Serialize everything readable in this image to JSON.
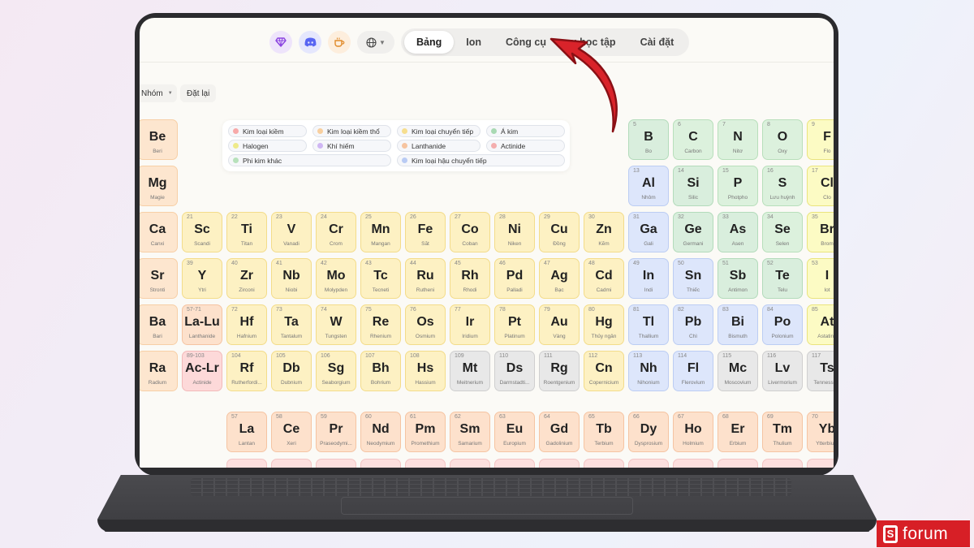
{
  "nav": {
    "tabs": [
      {
        "label": "Bảng",
        "active": true
      },
      {
        "label": "Ion",
        "active": false
      },
      {
        "label": "Công cụ",
        "active": false
      },
      {
        "label": "u học tập",
        "active": false
      },
      {
        "label": "Cài đặt",
        "active": false
      }
    ],
    "icons": [
      "gem-icon",
      "discord-icon",
      "coffee-icon",
      "globe-icon"
    ]
  },
  "controls": {
    "group_label": "Nhóm",
    "reset_label": "Đặt lại"
  },
  "legend": [
    {
      "label": "Kim loại kiềm",
      "color": "#f7a9a9"
    },
    {
      "label": "Kim loại kiềm thổ",
      "color": "#f8cf9f"
    },
    {
      "label": "Kim loại chuyển tiếp",
      "color": "#f6de8f"
    },
    {
      "label": "Á kim",
      "color": "#a9d9b3"
    },
    {
      "label": "Halogen",
      "color": "#eeea8a"
    },
    {
      "label": "Khí hiếm",
      "color": "#cfb6f3"
    },
    {
      "label": "Lanthanide",
      "color": "#f6c4a0"
    },
    {
      "label": "Actinide",
      "color": "#f4aeae"
    },
    {
      "label": "Phi kim khác",
      "color": "#b7e1bb"
    },
    {
      "label": "Kim loại hậu chuyển tiếp",
      "color": "#b9cbf4"
    }
  ],
  "elements": [
    {
      "sym": "Be",
      "name": "Beri",
      "num": "",
      "col": 0,
      "row": 0,
      "cat": "alkaline"
    },
    {
      "sym": "Mg",
      "name": "Magie",
      "num": "",
      "col": 0,
      "row": 1,
      "cat": "alkaline"
    },
    {
      "sym": "Ca",
      "name": "Canxi",
      "num": "",
      "col": 0,
      "row": 2,
      "cat": "alkaline"
    },
    {
      "sym": "Sr",
      "name": "Stronti",
      "num": "",
      "col": 0,
      "row": 3,
      "cat": "alkaline"
    },
    {
      "sym": "Ba",
      "name": "Bari",
      "num": "",
      "col": 0,
      "row": 4,
      "cat": "alkaline"
    },
    {
      "sym": "Ra",
      "name": "Radium",
      "num": "",
      "col": 0,
      "row": 5,
      "cat": "alkaline"
    },
    {
      "sym": "Sc",
      "name": "Scandi",
      "num": "21",
      "col": 1,
      "row": 2,
      "cat": "transition"
    },
    {
      "sym": "Ti",
      "name": "Titan",
      "num": "22",
      "col": 2,
      "row": 2,
      "cat": "transition"
    },
    {
      "sym": "V",
      "name": "Vanadi",
      "num": "23",
      "col": 3,
      "row": 2,
      "cat": "transition"
    },
    {
      "sym": "Cr",
      "name": "Crom",
      "num": "24",
      "col": 4,
      "row": 2,
      "cat": "transition"
    },
    {
      "sym": "Mn",
      "name": "Mangan",
      "num": "25",
      "col": 5,
      "row": 2,
      "cat": "transition"
    },
    {
      "sym": "Fe",
      "name": "Sắt",
      "num": "26",
      "col": 6,
      "row": 2,
      "cat": "transition"
    },
    {
      "sym": "Co",
      "name": "Coban",
      "num": "27",
      "col": 7,
      "row": 2,
      "cat": "transition"
    },
    {
      "sym": "Ni",
      "name": "Niken",
      "num": "28",
      "col": 8,
      "row": 2,
      "cat": "transition"
    },
    {
      "sym": "Cu",
      "name": "Đồng",
      "num": "29",
      "col": 9,
      "row": 2,
      "cat": "transition"
    },
    {
      "sym": "Zn",
      "name": "Kẽm",
      "num": "30",
      "col": 10,
      "row": 2,
      "cat": "transition"
    },
    {
      "sym": "Y",
      "name": "Ytri",
      "num": "39",
      "col": 1,
      "row": 3,
      "cat": "transition"
    },
    {
      "sym": "Zr",
      "name": "Zirconi",
      "num": "40",
      "col": 2,
      "row": 3,
      "cat": "transition"
    },
    {
      "sym": "Nb",
      "name": "Niobi",
      "num": "41",
      "col": 3,
      "row": 3,
      "cat": "transition"
    },
    {
      "sym": "Mo",
      "name": "Molypden",
      "num": "42",
      "col": 4,
      "row": 3,
      "cat": "transition"
    },
    {
      "sym": "Tc",
      "name": "Tecneti",
      "num": "43",
      "col": 5,
      "row": 3,
      "cat": "transition"
    },
    {
      "sym": "Ru",
      "name": "Rutheni",
      "num": "44",
      "col": 6,
      "row": 3,
      "cat": "transition"
    },
    {
      "sym": "Rh",
      "name": "Rhodi",
      "num": "45",
      "col": 7,
      "row": 3,
      "cat": "transition"
    },
    {
      "sym": "Pd",
      "name": "Palladi",
      "num": "46",
      "col": 8,
      "row": 3,
      "cat": "transition"
    },
    {
      "sym": "Ag",
      "name": "Bạc",
      "num": "47",
      "col": 9,
      "row": 3,
      "cat": "transition"
    },
    {
      "sym": "Cd",
      "name": "Cadmi",
      "num": "48",
      "col": 10,
      "row": 3,
      "cat": "transition"
    },
    {
      "sym": "La-Lu",
      "name": "Lanthanide",
      "num": "57-71",
      "col": 1,
      "row": 4,
      "cat": "lanthanide"
    },
    {
      "sym": "Hf",
      "name": "Hafnium",
      "num": "72",
      "col": 2,
      "row": 4,
      "cat": "transition"
    },
    {
      "sym": "Ta",
      "name": "Tantalum",
      "num": "73",
      "col": 3,
      "row": 4,
      "cat": "transition"
    },
    {
      "sym": "W",
      "name": "Tungsten",
      "num": "74",
      "col": 4,
      "row": 4,
      "cat": "transition"
    },
    {
      "sym": "Re",
      "name": "Rhenium",
      "num": "75",
      "col": 5,
      "row": 4,
      "cat": "transition"
    },
    {
      "sym": "Os",
      "name": "Osmium",
      "num": "76",
      "col": 6,
      "row": 4,
      "cat": "transition"
    },
    {
      "sym": "Ir",
      "name": "Iridium",
      "num": "77",
      "col": 7,
      "row": 4,
      "cat": "transition"
    },
    {
      "sym": "Pt",
      "name": "Platinum",
      "num": "78",
      "col": 8,
      "row": 4,
      "cat": "transition"
    },
    {
      "sym": "Au",
      "name": "Vàng",
      "num": "79",
      "col": 9,
      "row": 4,
      "cat": "transition"
    },
    {
      "sym": "Hg",
      "name": "Thủy ngân",
      "num": "80",
      "col": 10,
      "row": 4,
      "cat": "transition"
    },
    {
      "sym": "Ac-Lr",
      "name": "Actinide",
      "num": "89-103",
      "col": 1,
      "row": 5,
      "cat": "actinide"
    },
    {
      "sym": "Rf",
      "name": "Rutherfordi...",
      "num": "104",
      "col": 2,
      "row": 5,
      "cat": "transition"
    },
    {
      "sym": "Db",
      "name": "Dubnium",
      "num": "105",
      "col": 3,
      "row": 5,
      "cat": "transition"
    },
    {
      "sym": "Sg",
      "name": "Seaborgium",
      "num": "106",
      "col": 4,
      "row": 5,
      "cat": "transition"
    },
    {
      "sym": "Bh",
      "name": "Bohrium",
      "num": "107",
      "col": 5,
      "row": 5,
      "cat": "transition"
    },
    {
      "sym": "Hs",
      "name": "Hassium",
      "num": "108",
      "col": 6,
      "row": 5,
      "cat": "transition"
    },
    {
      "sym": "Mt",
      "name": "Meitnerium",
      "num": "109",
      "col": 7,
      "row": 5,
      "cat": "unknown"
    },
    {
      "sym": "Ds",
      "name": "Darmstadti...",
      "num": "110",
      "col": 8,
      "row": 5,
      "cat": "unknown"
    },
    {
      "sym": "Rg",
      "name": "Roentgenium",
      "num": "111",
      "col": 9,
      "row": 5,
      "cat": "unknown"
    },
    {
      "sym": "Cn",
      "name": "Copernicium",
      "num": "112",
      "col": 10,
      "row": 5,
      "cat": "transition"
    },
    {
      "sym": "B",
      "name": "Bo",
      "num": "5",
      "col": 11,
      "row": 0,
      "cat": "metalloid"
    },
    {
      "sym": "C",
      "name": "Carbon",
      "num": "6",
      "col": 12,
      "row": 0,
      "cat": "nonmetal"
    },
    {
      "sym": "N",
      "name": "Nitơ",
      "num": "7",
      "col": 13,
      "row": 0,
      "cat": "nonmetal"
    },
    {
      "sym": "O",
      "name": "Oxy",
      "num": "8",
      "col": 14,
      "row": 0,
      "cat": "nonmetal"
    },
    {
      "sym": "F",
      "name": "Flo",
      "num": "9",
      "col": 15,
      "row": 0,
      "cat": "halogen"
    },
    {
      "sym": "Al",
      "name": "Nhôm",
      "num": "13",
      "col": 11,
      "row": 1,
      "cat": "post"
    },
    {
      "sym": "Si",
      "name": "Silic",
      "num": "14",
      "col": 12,
      "row": 1,
      "cat": "metalloid"
    },
    {
      "sym": "P",
      "name": "Photpho",
      "num": "15",
      "col": 13,
      "row": 1,
      "cat": "nonmetal"
    },
    {
      "sym": "S",
      "name": "Lưu huỳnh",
      "num": "16",
      "col": 14,
      "row": 1,
      "cat": "nonmetal"
    },
    {
      "sym": "Cl",
      "name": "Clo",
      "num": "17",
      "col": 15,
      "row": 1,
      "cat": "halogen"
    },
    {
      "sym": "Ga",
      "name": "Gali",
      "num": "31",
      "col": 11,
      "row": 2,
      "cat": "post"
    },
    {
      "sym": "Ge",
      "name": "Germani",
      "num": "32",
      "col": 12,
      "row": 2,
      "cat": "metalloid"
    },
    {
      "sym": "As",
      "name": "Asen",
      "num": "33",
      "col": 13,
      "row": 2,
      "cat": "metalloid"
    },
    {
      "sym": "Se",
      "name": "Selen",
      "num": "34",
      "col": 14,
      "row": 2,
      "cat": "nonmetal"
    },
    {
      "sym": "Br",
      "name": "Brom",
      "num": "35",
      "col": 15,
      "row": 2,
      "cat": "halogen"
    },
    {
      "sym": "In",
      "name": "Indi",
      "num": "49",
      "col": 11,
      "row": 3,
      "cat": "post"
    },
    {
      "sym": "Sn",
      "name": "Thiếc",
      "num": "50",
      "col": 12,
      "row": 3,
      "cat": "post"
    },
    {
      "sym": "Sb",
      "name": "Antimon",
      "num": "51",
      "col": 13,
      "row": 3,
      "cat": "metalloid"
    },
    {
      "sym": "Te",
      "name": "Telu",
      "num": "52",
      "col": 14,
      "row": 3,
      "cat": "metalloid"
    },
    {
      "sym": "I",
      "name": "Iot",
      "num": "53",
      "col": 15,
      "row": 3,
      "cat": "halogen"
    },
    {
      "sym": "Tl",
      "name": "Thallium",
      "num": "81",
      "col": 11,
      "row": 4,
      "cat": "post"
    },
    {
      "sym": "Pb",
      "name": "Chì",
      "num": "82",
      "col": 12,
      "row": 4,
      "cat": "post"
    },
    {
      "sym": "Bi",
      "name": "Bismuth",
      "num": "83",
      "col": 13,
      "row": 4,
      "cat": "post"
    },
    {
      "sym": "Po",
      "name": "Polonium",
      "num": "84",
      "col": 14,
      "row": 4,
      "cat": "post"
    },
    {
      "sym": "At",
      "name": "Astatine",
      "num": "85",
      "col": 15,
      "row": 4,
      "cat": "halogen"
    },
    {
      "sym": "Nh",
      "name": "Nihonium",
      "num": "113",
      "col": 11,
      "row": 5,
      "cat": "post"
    },
    {
      "sym": "Fl",
      "name": "Flerovium",
      "num": "114",
      "col": 12,
      "row": 5,
      "cat": "post"
    },
    {
      "sym": "Mc",
      "name": "Moscovium",
      "num": "115",
      "col": 13,
      "row": 5,
      "cat": "unknown"
    },
    {
      "sym": "Lv",
      "name": "Livermorium",
      "num": "116",
      "col": 14,
      "row": 5,
      "cat": "unknown"
    },
    {
      "sym": "Ts",
      "name": "Tennessine",
      "num": "117",
      "col": 15,
      "row": 5,
      "cat": "unknown"
    },
    {
      "sym": "La",
      "name": "Lantan",
      "num": "57",
      "col": 2,
      "row": 6,
      "cat": "lanthanide"
    },
    {
      "sym": "Ce",
      "name": "Xeri",
      "num": "58",
      "col": 3,
      "row": 6,
      "cat": "lanthanide"
    },
    {
      "sym": "Pr",
      "name": "Praseodymi...",
      "num": "59",
      "col": 4,
      "row": 6,
      "cat": "lanthanide"
    },
    {
      "sym": "Nd",
      "name": "Neodymium",
      "num": "60",
      "col": 5,
      "row": 6,
      "cat": "lanthanide"
    },
    {
      "sym": "Pm",
      "name": "Promethium",
      "num": "61",
      "col": 6,
      "row": 6,
      "cat": "lanthanide"
    },
    {
      "sym": "Sm",
      "name": "Samarium",
      "num": "62",
      "col": 7,
      "row": 6,
      "cat": "lanthanide"
    },
    {
      "sym": "Eu",
      "name": "Europium",
      "num": "63",
      "col": 8,
      "row": 6,
      "cat": "lanthanide"
    },
    {
      "sym": "Gd",
      "name": "Gadolinium",
      "num": "64",
      "col": 9,
      "row": 6,
      "cat": "lanthanide"
    },
    {
      "sym": "Tb",
      "name": "Terbium",
      "num": "65",
      "col": 10,
      "row": 6,
      "cat": "lanthanide"
    },
    {
      "sym": "Dy",
      "name": "Dysprosium",
      "num": "66",
      "col": 11,
      "row": 6,
      "cat": "lanthanide"
    },
    {
      "sym": "Ho",
      "name": "Holmium",
      "num": "67",
      "col": 12,
      "row": 6,
      "cat": "lanthanide"
    },
    {
      "sym": "Er",
      "name": "Erbium",
      "num": "68",
      "col": 13,
      "row": 6,
      "cat": "lanthanide"
    },
    {
      "sym": "Tm",
      "name": "Thulium",
      "num": "69",
      "col": 14,
      "row": 6,
      "cat": "lanthanide"
    },
    {
      "sym": "Yb",
      "name": "Ytterbium",
      "num": "70",
      "col": 15,
      "row": 6,
      "cat": "lanthanide"
    }
  ],
  "watermark": {
    "letter": "S",
    "text": "forum",
    "color": "#d71f26"
  },
  "arrow_color": "#d9232a"
}
